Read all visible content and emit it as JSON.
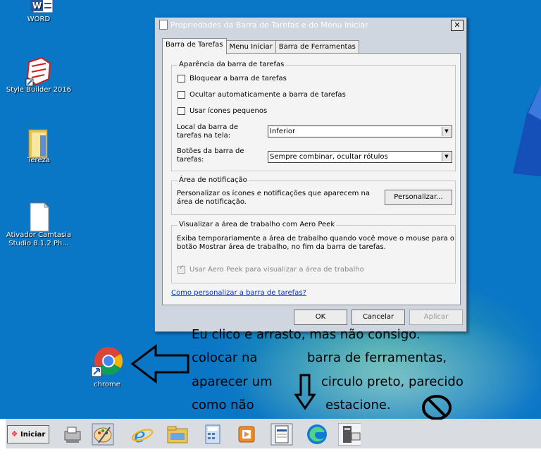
{
  "desktop": {
    "icons": [
      {
        "label": "WORD"
      },
      {
        "label": "Style Builder 2016"
      },
      {
        "label": "Tereza"
      },
      {
        "label_line1": "Ativador Camtasia",
        "label_line2": "Studio 8.1.2 Ph..."
      },
      {
        "label": "chrome"
      }
    ]
  },
  "dialog": {
    "title": "Propriedades da Barra de Tarefas e do Menu Iniciar",
    "close_label": "✕",
    "tabs": [
      "Barra de Tarefas",
      "Menu Iniciar",
      "Barra de Ferramentas"
    ],
    "appearance": {
      "legend": "Aparência da barra de tarefas",
      "lock_label": "Bloquear a barra de tarefas",
      "autohide_label": "Ocultar automaticamente a barra de tarefas",
      "small_icons_label": "Usar ícones pequenos",
      "location_label_1": "Local da barra de",
      "location_label_2": "tarefas na tela:",
      "location_value": "Inferior",
      "buttons_label_1": "Botões da barra de",
      "buttons_label_2": "tarefas:",
      "buttons_value": "Sempre combinar, ocultar rótulos"
    },
    "notification": {
      "legend": "Área de notificação",
      "text_1": "Personalizar os ícones e notificações que aparecem na",
      "text_2": "área de notificação.",
      "customize_label": "Personalizar..."
    },
    "peek": {
      "legend": "Visualizar a área de trabalho com Aero Peek",
      "text_1": "Exiba temporariamente a área de trabalho quando você move o mouse para o",
      "text_2": "botão Mostrar área de trabalho, no fim da barra de tarefas.",
      "checkbox_label": "Usar Aero Peek para visualizar a área de trabalho"
    },
    "help_link": "Como personalizar a barra de tarefas?",
    "ok_label": "OK",
    "cancel_label": "Cancelar",
    "apply_label": "Aplicar"
  },
  "annotation": {
    "line1": "Eu clico e arrasto, mas não consigo.",
    "line2a": "colocar na",
    "line2b": "barra de ferramentas,",
    "line3a": "aparecer um",
    "line3b": "circulo preto, parecido",
    "line4a": "como não",
    "line4b": "estacione."
  },
  "taskbar": {
    "start_label": "Iniciar"
  },
  "colors": {
    "desktop": "#0a76c6",
    "dialog_frame": "#cfd6df",
    "link": "#0033cc"
  }
}
